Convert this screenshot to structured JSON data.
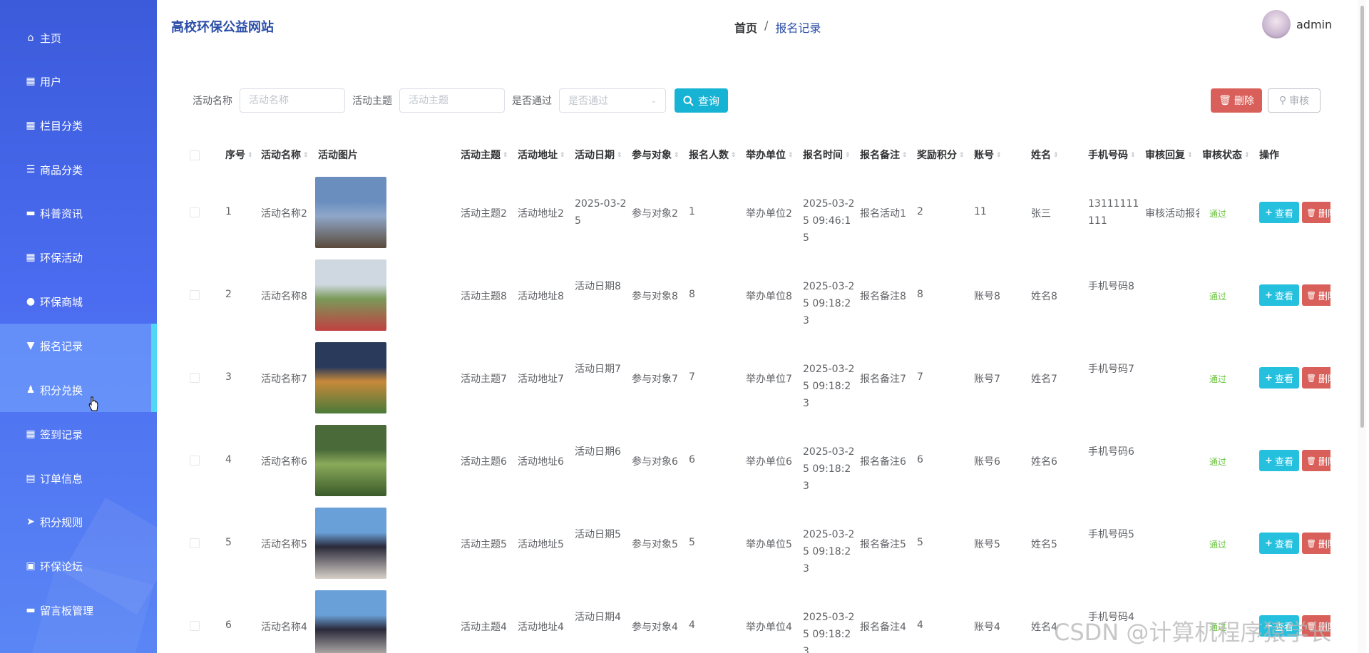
{
  "sidebar": {
    "items": [
      {
        "label": "主页",
        "icon": "home-icon",
        "glyph": "⌂"
      },
      {
        "label": "用户",
        "icon": "grid-icon",
        "glyph": "▦"
      },
      {
        "label": "栏目分类",
        "icon": "grid-icon",
        "glyph": "▦"
      },
      {
        "label": "商品分类",
        "icon": "list-icon",
        "glyph": "☰"
      },
      {
        "label": "科普资讯",
        "icon": "monitor-icon",
        "glyph": "▬"
      },
      {
        "label": "环保活动",
        "icon": "grid-icon",
        "glyph": "▦"
      },
      {
        "label": "环保商城",
        "icon": "bulb-icon",
        "glyph": "●"
      },
      {
        "label": "报名记录",
        "icon": "pin-icon",
        "glyph": "▼"
      },
      {
        "label": "积分兑换",
        "icon": "user-icon",
        "glyph": "♟"
      },
      {
        "label": "签到记录",
        "icon": "grid-icon",
        "glyph": "▦"
      },
      {
        "label": "订单信息",
        "icon": "table-icon",
        "glyph": "▤"
      },
      {
        "label": "积分规则",
        "icon": "send-icon",
        "glyph": "➤"
      },
      {
        "label": "环保论坛",
        "icon": "briefcase-icon",
        "glyph": "▣"
      },
      {
        "label": "留言板管理",
        "icon": "message-icon",
        "glyph": "▬"
      }
    ]
  },
  "header": {
    "site_title": "高校环保公益网站",
    "breadcrumb_home": "首页",
    "breadcrumb_sep": "/",
    "breadcrumb_current": "报名记录",
    "username": "admin"
  },
  "search": {
    "label_name": "活动名称",
    "placeholder_name": "活动名称",
    "label_theme": "活动主题",
    "placeholder_theme": "活动主题",
    "label_pass": "是否通过",
    "placeholder_pass": "是否通过",
    "query_label": "查询",
    "delete_label": "删除",
    "audit_label": "审核"
  },
  "table": {
    "columns": [
      "序号",
      "活动名称",
      "活动图片",
      "活动主题",
      "活动地址",
      "活动日期",
      "参与对象",
      "报名人数",
      "举办单位",
      "报名时间",
      "报名备注",
      "奖励积分",
      "账号",
      "姓名",
      "手机号码",
      "审核回复",
      "审核状态",
      "操作"
    ],
    "view_label": "查看",
    "delete_label": "删除",
    "rows": [
      {
        "idx": "1",
        "name": "活动名称2",
        "theme": "活动主题2",
        "addr": "活动地址2",
        "date": "2025-03-25",
        "target": "参与对象2",
        "count": "1",
        "org": "举办单位2",
        "time": "2025-03-25 09:46:15",
        "note": "报名活动1",
        "points": "2",
        "account": "11",
        "person": "张三",
        "phone": "13111111111",
        "reply": "审核活动报名",
        "status": "通过",
        "img": [
          "#6a8fbf",
          "#8fa7c9",
          "#5a4a3a"
        ]
      },
      {
        "idx": "2",
        "name": "活动名称8",
        "theme": "活动主题8",
        "addr": "活动地址8",
        "date": "活动日期8",
        "target": "参与对象8",
        "count": "8",
        "org": "举办单位8",
        "time": "2025-03-25 09:18:23",
        "note": "报名备注8",
        "points": "8",
        "account": "账号8",
        "person": "姓名8",
        "phone": "手机号码8",
        "reply": "",
        "status": "通过",
        "img": [
          "#cfd8e0",
          "#7a9a5a",
          "#c04040"
        ]
      },
      {
        "idx": "3",
        "name": "活动名称7",
        "theme": "活动主题7",
        "addr": "活动地址7",
        "date": "活动日期7",
        "target": "参与对象7",
        "count": "7",
        "org": "举办单位7",
        "time": "2025-03-25 09:18:23",
        "note": "报名备注7",
        "points": "7",
        "account": "账号7",
        "person": "姓名7",
        "phone": "手机号码7",
        "reply": "",
        "status": "通过",
        "img": [
          "#2a3a5a",
          "#c8893a",
          "#4a7a3a"
        ]
      },
      {
        "idx": "4",
        "name": "活动名称6",
        "theme": "活动主题6",
        "addr": "活动地址6",
        "date": "活动日期6",
        "target": "参与对象6",
        "count": "6",
        "org": "举办单位6",
        "time": "2025-03-25 09:18:23",
        "note": "报名备注6",
        "points": "6",
        "account": "账号6",
        "person": "姓名6",
        "phone": "手机号码6",
        "reply": "",
        "status": "通过",
        "img": [
          "#4a6a3a",
          "#8aaa5a",
          "#3a5a2a"
        ]
      },
      {
        "idx": "5",
        "name": "活动名称5",
        "theme": "活动主题5",
        "addr": "活动地址5",
        "date": "活动日期5",
        "target": "参与对象5",
        "count": "5",
        "org": "举办单位5",
        "time": "2025-03-25 09:18:23",
        "note": "报名备注5",
        "points": "5",
        "account": "账号5",
        "person": "姓名5",
        "phone": "手机号码5",
        "reply": "",
        "status": "通过",
        "img": [
          "#6aa0d8",
          "#2a2a3a",
          "#d8d0c8"
        ]
      },
      {
        "idx": "6",
        "name": "活动名称4",
        "theme": "活动主题4",
        "addr": "活动地址4",
        "date": "活动日期4",
        "target": "参与对象4",
        "count": "4",
        "org": "举办单位4",
        "time": "2025-03-25 09:18:23",
        "note": "报名备注4",
        "points": "4",
        "account": "账号4",
        "person": "姓名4",
        "phone": "手机号码4",
        "reply": "",
        "status": "通过",
        "img": [
          "#6aa0d8",
          "#2a2a3a",
          "#d8d0c8"
        ]
      }
    ]
  },
  "watermark": "CSDN @计算机程序猿学长"
}
